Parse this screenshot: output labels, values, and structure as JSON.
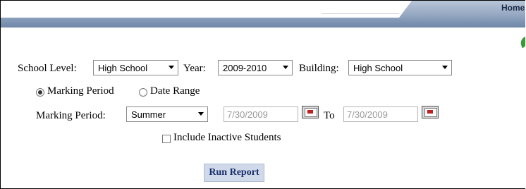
{
  "header": {
    "home_label": "Home"
  },
  "filters": {
    "school_level_label": "School Level:",
    "school_level_value": "High School",
    "year_label": "Year:",
    "year_value": "2009-2010",
    "building_label": "Building:",
    "building_value": "High School"
  },
  "range_mode": {
    "marking_period_option": "Marking Period",
    "date_range_option": "Date Range",
    "selected": "Marking Period"
  },
  "marking_period": {
    "label": "Marking Period:",
    "value": "Summer",
    "start_date": "7/30/2009",
    "to_label": "To",
    "end_date": "7/30/2009"
  },
  "options": {
    "include_inactive_label": "Include Inactive Students",
    "include_inactive_checked": false
  },
  "actions": {
    "run_report_label": "Run Report"
  }
}
